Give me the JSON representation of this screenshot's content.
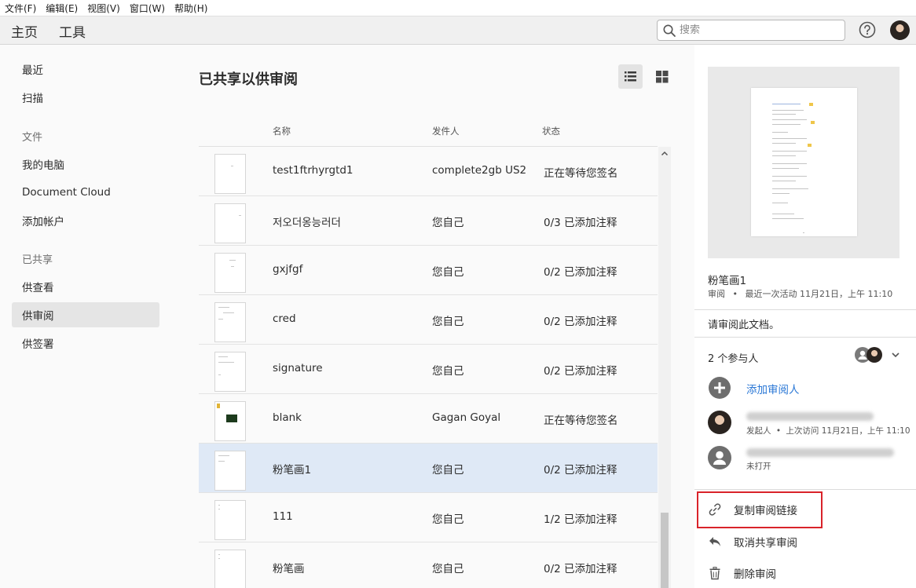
{
  "menu": [
    "文件(F)",
    "编辑(E)",
    "视图(V)",
    "窗口(W)",
    "帮助(H)"
  ],
  "nav": {
    "tabs": [
      {
        "label": "主页",
        "active": true
      },
      {
        "label": "工具",
        "active": false
      }
    ],
    "search_placeholder": "搜索"
  },
  "sidebar": {
    "group1": [
      "最近",
      "扫描"
    ],
    "files_header": "文件",
    "files": [
      "我的电脑",
      "Document Cloud",
      "添加帐户"
    ],
    "shared_header": "已共享",
    "shared": [
      "供查看",
      "供审阅",
      "供签署"
    ],
    "active_item": "供审阅"
  },
  "main": {
    "title": "已共享以供审阅",
    "columns": {
      "name": "名称",
      "sender": "发件人",
      "status": "状态"
    },
    "rows": [
      {
        "name": "test1ftrhyrgtd1",
        "sender": "complete2gb US2",
        "status": "正在等待您签名"
      },
      {
        "name": "저오더옹능러더",
        "sender": "您自己",
        "status": "0/3 已添加注释"
      },
      {
        "name": "gxjfgf",
        "sender": "您自己",
        "status": "0/2 已添加注释"
      },
      {
        "name": "cred",
        "sender": "您自己",
        "status": "0/2 已添加注释"
      },
      {
        "name": "signature",
        "sender": "您自己",
        "status": "0/2 已添加注释"
      },
      {
        "name": "blank",
        "sender": "Gagan Goyal",
        "status": "正在等待您签名"
      },
      {
        "name": "粉笔画1",
        "sender": "您自己",
        "status": "0/2 已添加注释"
      },
      {
        "name": "111",
        "sender": "您自己",
        "status": "1/2 已添加注释"
      },
      {
        "name": "粉笔画",
        "sender": "您自己",
        "status": "0/2 已添加注释"
      }
    ],
    "selected_row": 6
  },
  "details": {
    "doc_name": "粉笔画1",
    "doc_type": "审阅",
    "last_activity": "最近一次活动 11月21日，上午 11:10",
    "message": "请审阅此文档。",
    "participants_label": "2 个参与人",
    "add_reviewer": "添加审阅人",
    "participants": [
      {
        "role": "发起人",
        "last_visit": "上次访问 11月21日，上午 11:10"
      },
      {
        "role": "未打开"
      }
    ],
    "actions": [
      "复制审阅链接",
      "取消共享审阅",
      "删除审阅"
    ]
  },
  "colors": {
    "accent_link": "#2b78d6",
    "selected_row": "#dfe9f6",
    "highlight_box": "#d9232a"
  }
}
